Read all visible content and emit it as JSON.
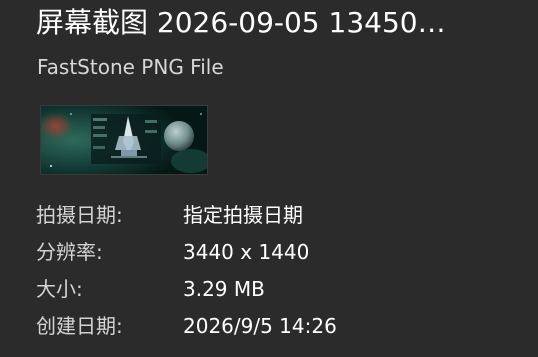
{
  "file": {
    "title": "屏幕截图 2026-09-05 13450…",
    "type": "FastStone PNG File"
  },
  "thumbnail": {
    "icon": "image-thumbnail"
  },
  "properties": [
    {
      "label": "拍摄日期:",
      "value": "指定拍摄日期"
    },
    {
      "label": "分辨率:",
      "value": "3440 x 1440"
    },
    {
      "label": "大小:",
      "value": "3.29 MB"
    },
    {
      "label": "创建日期:",
      "value": "2026/9/5 14:26"
    }
  ],
  "colors": {
    "background": "#2b2b2b",
    "text_primary": "#ffffff",
    "text_secondary": "#d4d4d4"
  }
}
